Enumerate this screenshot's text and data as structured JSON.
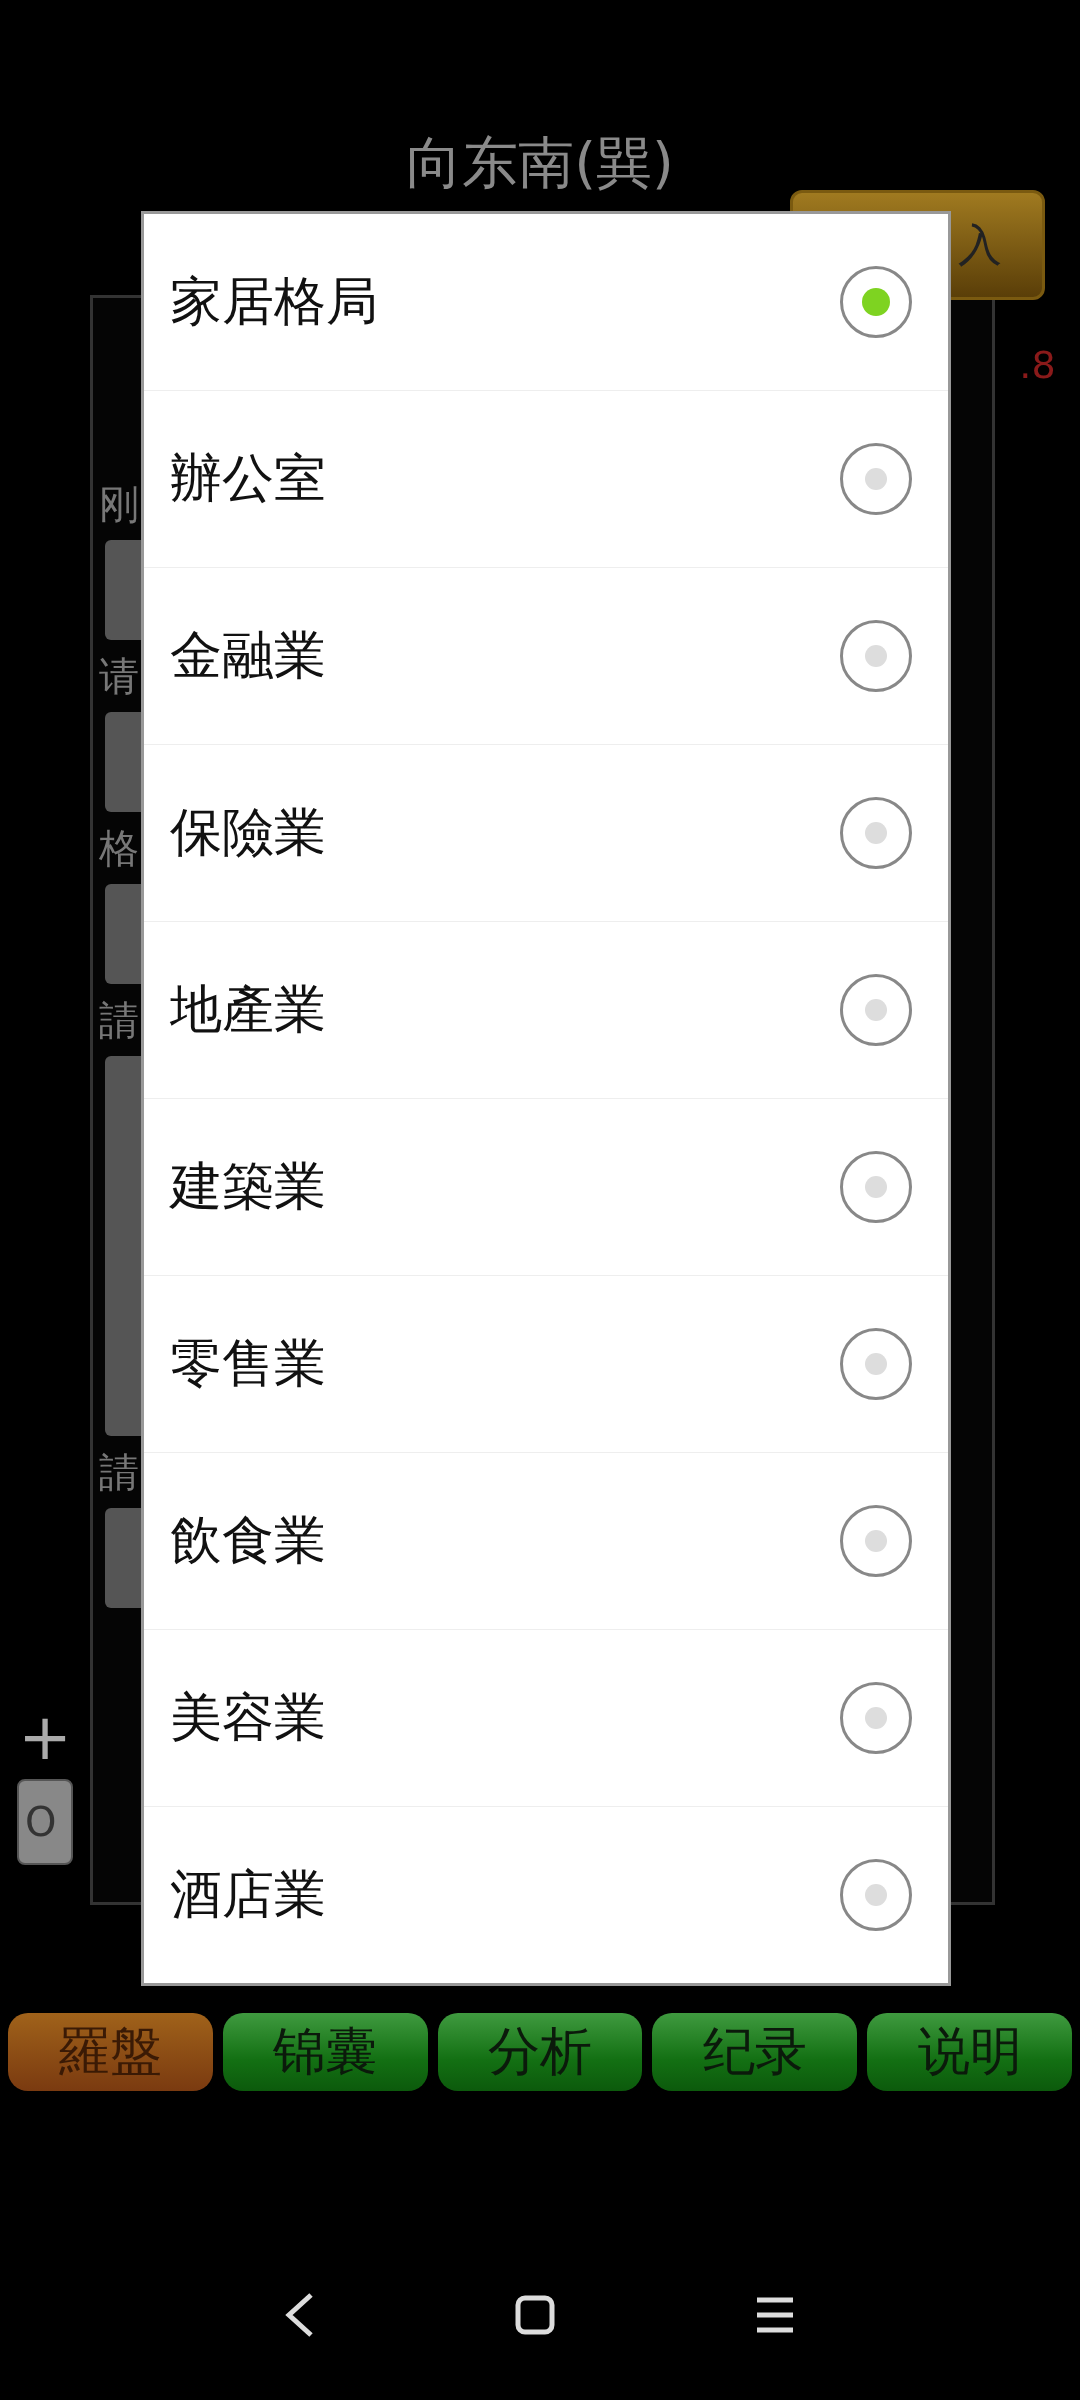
{
  "background": {
    "title": "向东南(巽)",
    "input_button": "入",
    "reading": ".8",
    "form_labels": [
      "刚",
      "请",
      "格",
      "請",
      "請"
    ],
    "plus": "+",
    "small_button": "O"
  },
  "dialog": {
    "options": [
      {
        "label": "家居格局",
        "selected": true
      },
      {
        "label": "辦公室",
        "selected": false
      },
      {
        "label": "金融業",
        "selected": false
      },
      {
        "label": "保險業",
        "selected": false
      },
      {
        "label": "地產業",
        "selected": false
      },
      {
        "label": "建築業",
        "selected": false
      },
      {
        "label": "零售業",
        "selected": false
      },
      {
        "label": "飲食業",
        "selected": false
      },
      {
        "label": "美容業",
        "selected": false
      },
      {
        "label": "酒店業",
        "selected": false
      }
    ]
  },
  "tabs": [
    {
      "label": "羅盤",
      "selected": true
    },
    {
      "label": "锦囊",
      "selected": false
    },
    {
      "label": "分析",
      "selected": false
    },
    {
      "label": "纪录",
      "selected": false
    },
    {
      "label": "说明",
      "selected": false
    }
  ]
}
